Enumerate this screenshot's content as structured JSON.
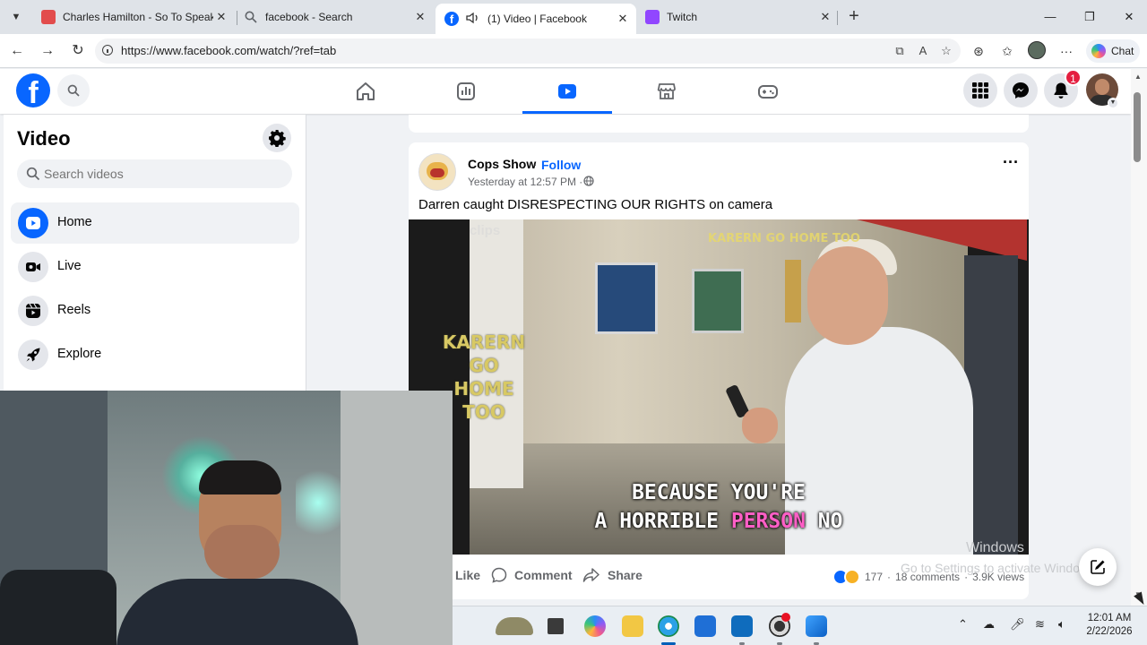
{
  "browser": {
    "tabs": [
      {
        "title": "Charles Hamilton - So To Speak 1",
        "icon": "youtube-icon",
        "color": "#e24c4c"
      },
      {
        "title": "facebook - Search",
        "icon": "search-icon"
      },
      {
        "title": "(1) Video | Facebook",
        "icon": "facebook-icon",
        "active": true,
        "muted_icon": "speaker-icon"
      },
      {
        "title": "Twitch",
        "icon": "twitch-icon",
        "color": "#9146ff"
      }
    ],
    "url": "https://www.facebook.com/watch/?ref=tab",
    "chat_label": "Chat"
  },
  "fb": {
    "nav": [
      "home-icon",
      "dashboard-icon",
      "video-icon",
      "marketplace-icon",
      "gaming-icon"
    ],
    "active_nav": "video",
    "notification_count": "1",
    "brand_color": "#0866ff"
  },
  "sidebar": {
    "title": "Video",
    "search_placeholder": "Search videos",
    "items": [
      {
        "label": "Home",
        "icon": "play-icon",
        "active": true
      },
      {
        "label": "Live",
        "icon": "live-camera-icon"
      },
      {
        "label": "Reels",
        "icon": "reels-icon"
      },
      {
        "label": "Explore",
        "icon": "rocket-icon"
      }
    ]
  },
  "post": {
    "page_name": "Cops Show",
    "separator": "·",
    "follow_label": "Follow",
    "time": "Yesterday at 12:57 PM ·",
    "text": "Darren caught DISRESPECTING OUR RIGHTS on camera",
    "video": {
      "overlay_side": "KARERN GO HOME TOO",
      "overlay_top": "KARERN GO HOME TOO",
      "watermark": "clips",
      "subtitle_line1": "BECAUSE YOU'RE",
      "subtitle_line2_pre": "A HORRIBLE ",
      "subtitle_line2_hl": "PERSON",
      "subtitle_line2_post": " NO"
    },
    "actions": {
      "like": "Like",
      "comment": "Comment",
      "share": "Share"
    },
    "stats": {
      "reactions": "177",
      "dot": "·",
      "comments": "18 comments",
      "views": "3.9K views"
    }
  },
  "os": {
    "watermark_line1": "Windows",
    "watermark_line2": "Go to Settings to activate Windows.",
    "time": "12:01 AM",
    "date": "2/22/2026"
  }
}
